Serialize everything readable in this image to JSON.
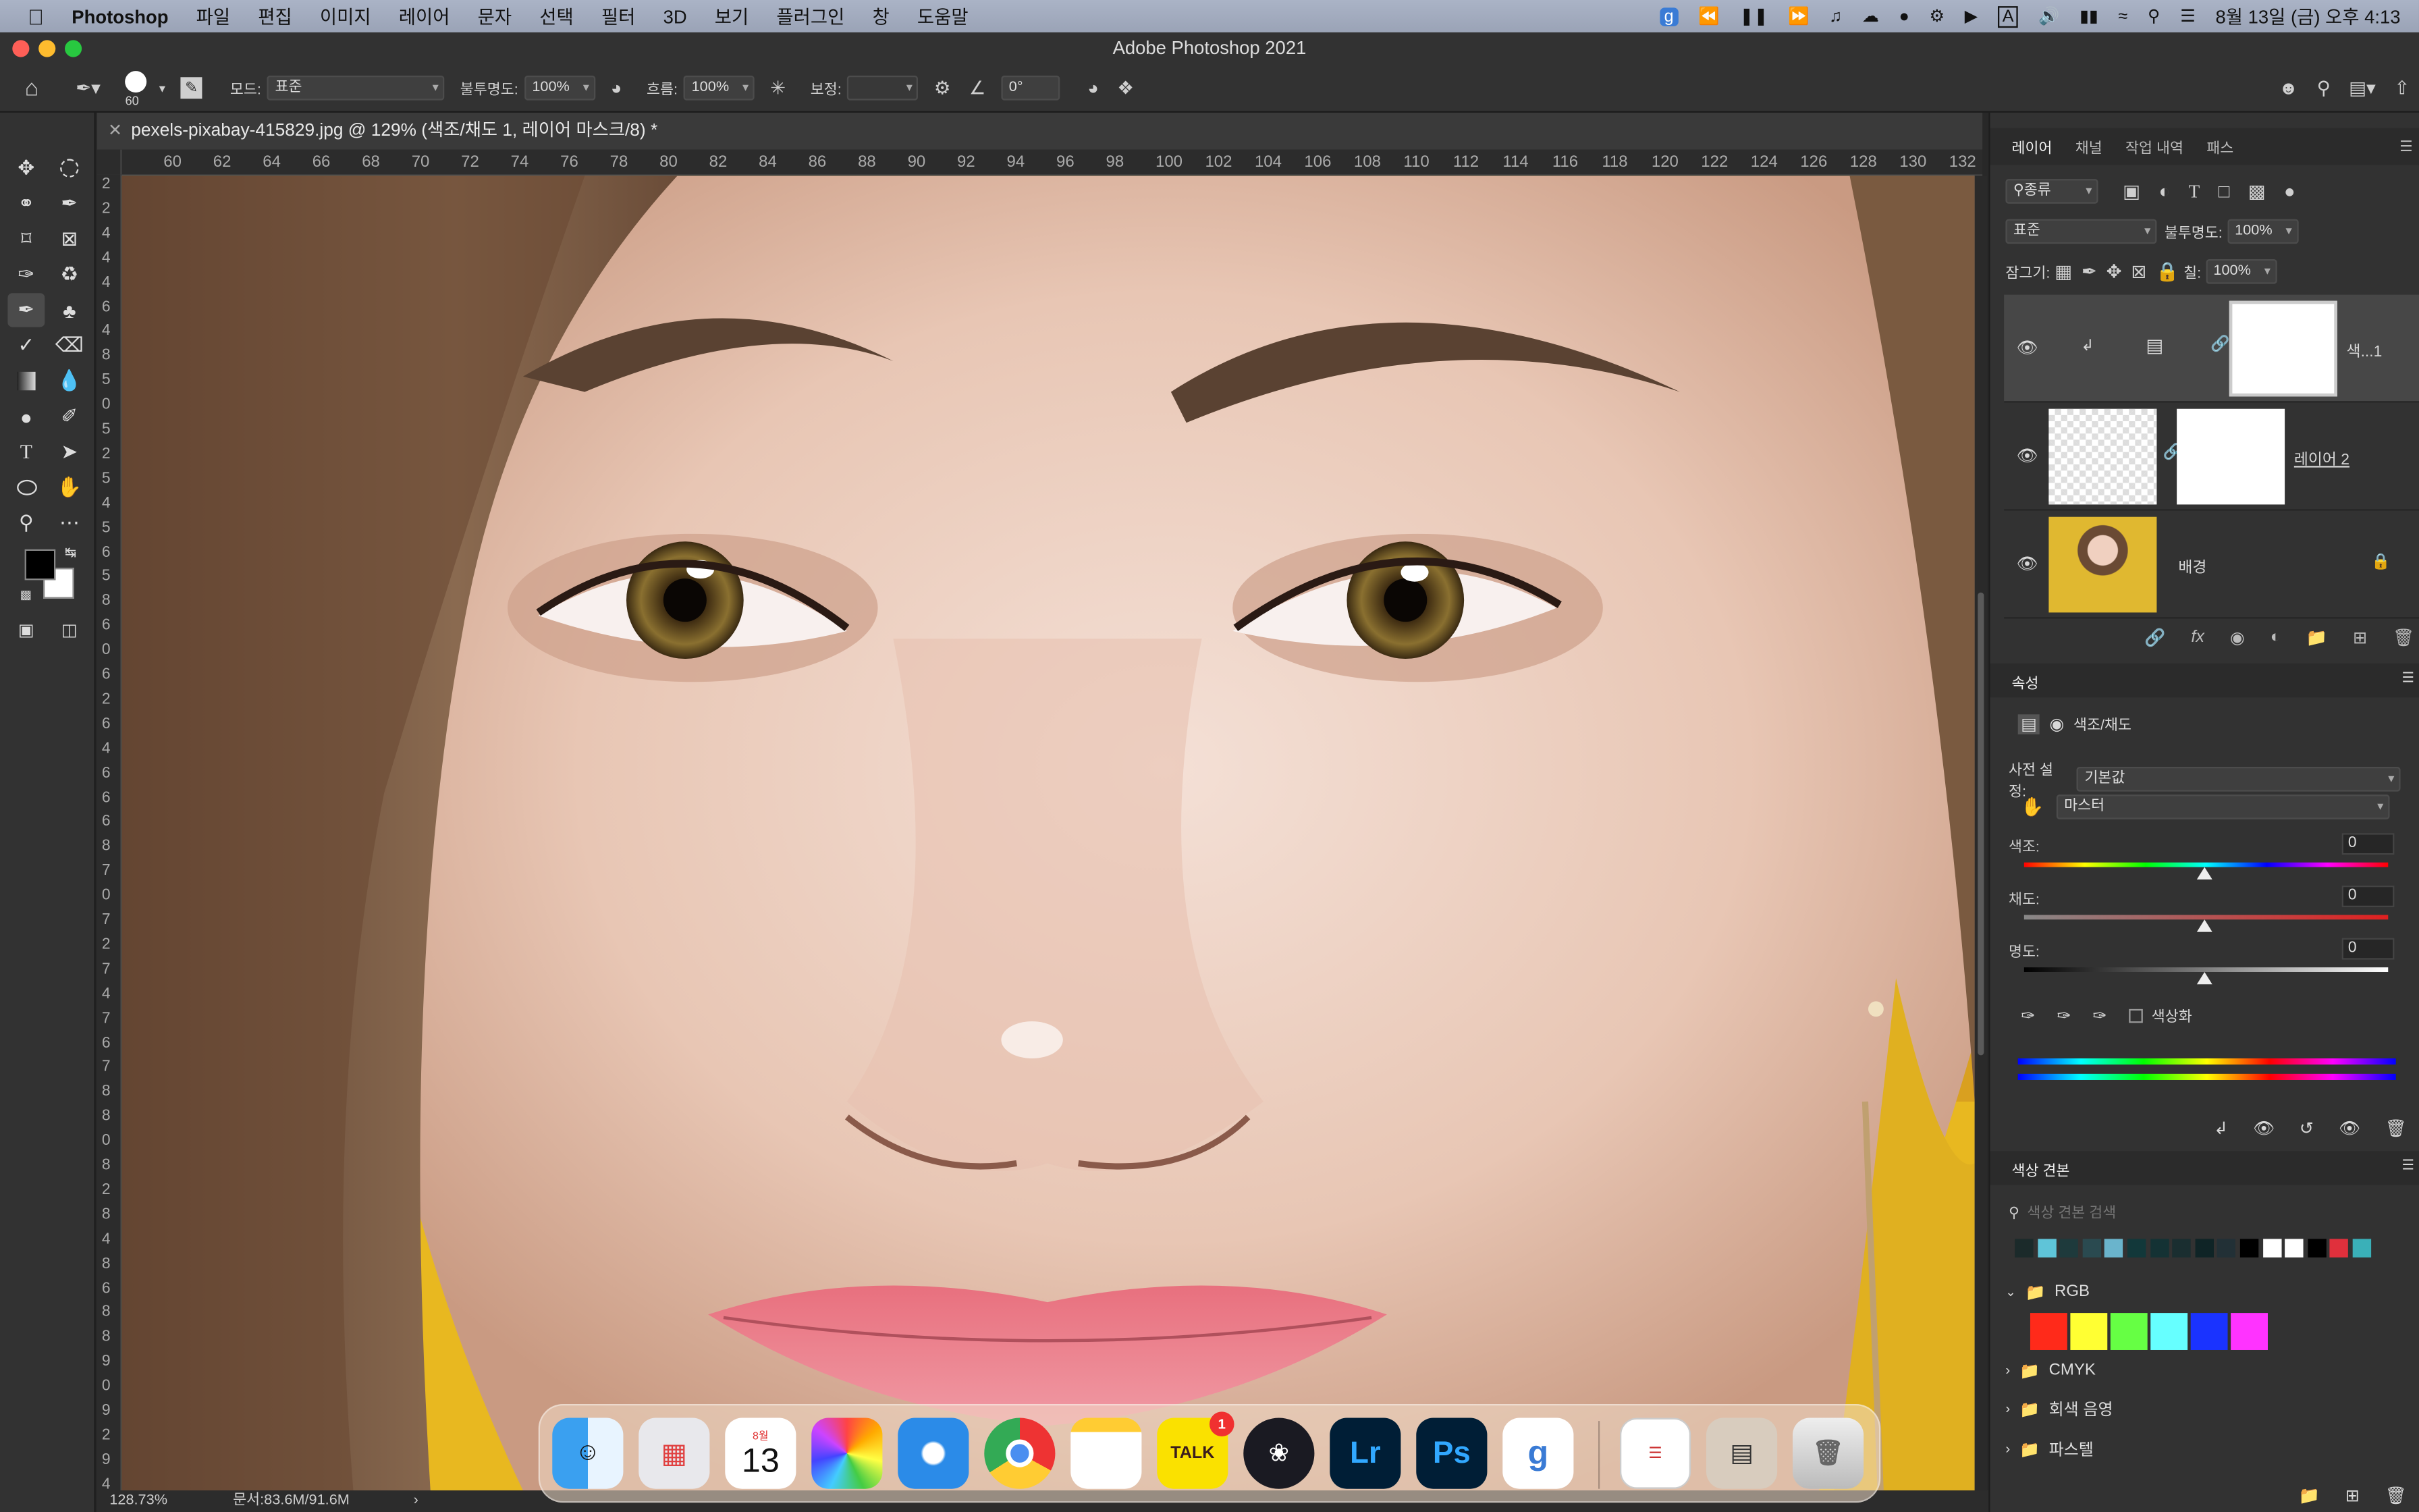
{
  "menubar": {
    "app_name": "Photoshop",
    "menus": [
      "파일",
      "편집",
      "이미지",
      "레이어",
      "문자",
      "선택",
      "필터",
      "3D",
      "보기",
      "플러그인",
      "창",
      "도움말"
    ],
    "datetime": "8월 13일 (금) 오후 4:13"
  },
  "window": {
    "title": "Adobe Photoshop 2021"
  },
  "options_bar": {
    "brush_size": "60",
    "mode_label": "모드:",
    "mode_value": "표준",
    "opacity_label": "불투명도:",
    "opacity_value": "100%",
    "flow_label": "흐름:",
    "flow_value": "100%",
    "smoothing_label": "보정:",
    "smoothing_value": "",
    "angle_value": "0°"
  },
  "document": {
    "tab_title": "pexels-pixabay-415829.jpg @ 129% (색조/채도 1, 레이어 마스크/8) *",
    "zoom": "128.73%",
    "doc_size": "문서:83.6M/91.6M",
    "h_ruler": [
      "60",
      "62",
      "64",
      "66",
      "68",
      "70",
      "72",
      "74",
      "76",
      "78",
      "80",
      "82",
      "84",
      "86",
      "88",
      "90",
      "92",
      "94",
      "96",
      "98",
      "100",
      "102",
      "104",
      "106",
      "108",
      "110",
      "112",
      "114",
      "116",
      "118",
      "120",
      "122",
      "124",
      "126",
      "128",
      "130",
      "132"
    ],
    "v_ruler": [
      "2",
      "2",
      "4",
      "4",
      "4",
      "6",
      "4",
      "8",
      "5",
      "0",
      "5",
      "2",
      "5",
      "4",
      "5",
      "6",
      "5",
      "8",
      "6",
      "0",
      "6",
      "2",
      "6",
      "4",
      "6",
      "6",
      "6",
      "8",
      "7",
      "0",
      "7",
      "2",
      "7",
      "4",
      "7",
      "6",
      "7",
      "8",
      "8",
      "0",
      "8",
      "2",
      "8",
      "4",
      "8",
      "6",
      "8",
      "8",
      "9",
      "0",
      "9",
      "2",
      "9",
      "4"
    ]
  },
  "layers_panel": {
    "tabs": [
      "레이어",
      "채널",
      "작업 내역",
      "패스"
    ],
    "filter_label": "종류",
    "blend_mode": "표준",
    "opacity_label": "불투명도:",
    "opacity_value": "100%",
    "lock_label": "잠그기:",
    "fill_label": "칠:",
    "fill_value": "100%",
    "layers": [
      {
        "name": "색...1"
      },
      {
        "name": "레이어 2"
      },
      {
        "name": "배경"
      }
    ]
  },
  "properties_panel": {
    "title": "속성",
    "adjustment_name": "색조/채도",
    "preset_label": "사전 설정:",
    "preset_value": "기본값",
    "channel_value": "마스터",
    "hue_label": "색조:",
    "hue_value": "0",
    "saturation_label": "채도:",
    "saturation_value": "0",
    "lightness_label": "명도:",
    "lightness_value": "0",
    "colorize_label": "색상화"
  },
  "swatches_panel": {
    "title": "색상 견본",
    "search_placeholder": "색상 견본 검색",
    "recent_colors": [
      "#1b2a2a",
      "#5fc4d8",
      "#1e3a3c",
      "#2a4a50",
      "#6ab4cc",
      "#12383a",
      "#143234",
      "#1a2e30",
      "#0f2426",
      "#223036",
      "#000000",
      "#ffffff",
      "#ffffff",
      "#000000",
      "#e0303c",
      "#3ab0b8"
    ],
    "groups": [
      {
        "name": "RGB",
        "colors": [
          "#ff2a1a",
          "#ffff33",
          "#66ff44",
          "#66ffff",
          "#1a33ff",
          "#ff33ff"
        ]
      },
      {
        "name": "CMYK"
      },
      {
        "name": "회색 음영"
      },
      {
        "name": "파스텔"
      }
    ]
  },
  "dock": {
    "calendar_month": "8월",
    "calendar_day": "13",
    "talk_label": "TALK",
    "talk_badge": "1",
    "lr_label": "Lr",
    "ps_label": "Ps",
    "g_label": "g"
  },
  "colors": {
    "accent": "#2b79d8",
    "panel_bg": "#323232",
    "canvas_bg": "#282828"
  }
}
